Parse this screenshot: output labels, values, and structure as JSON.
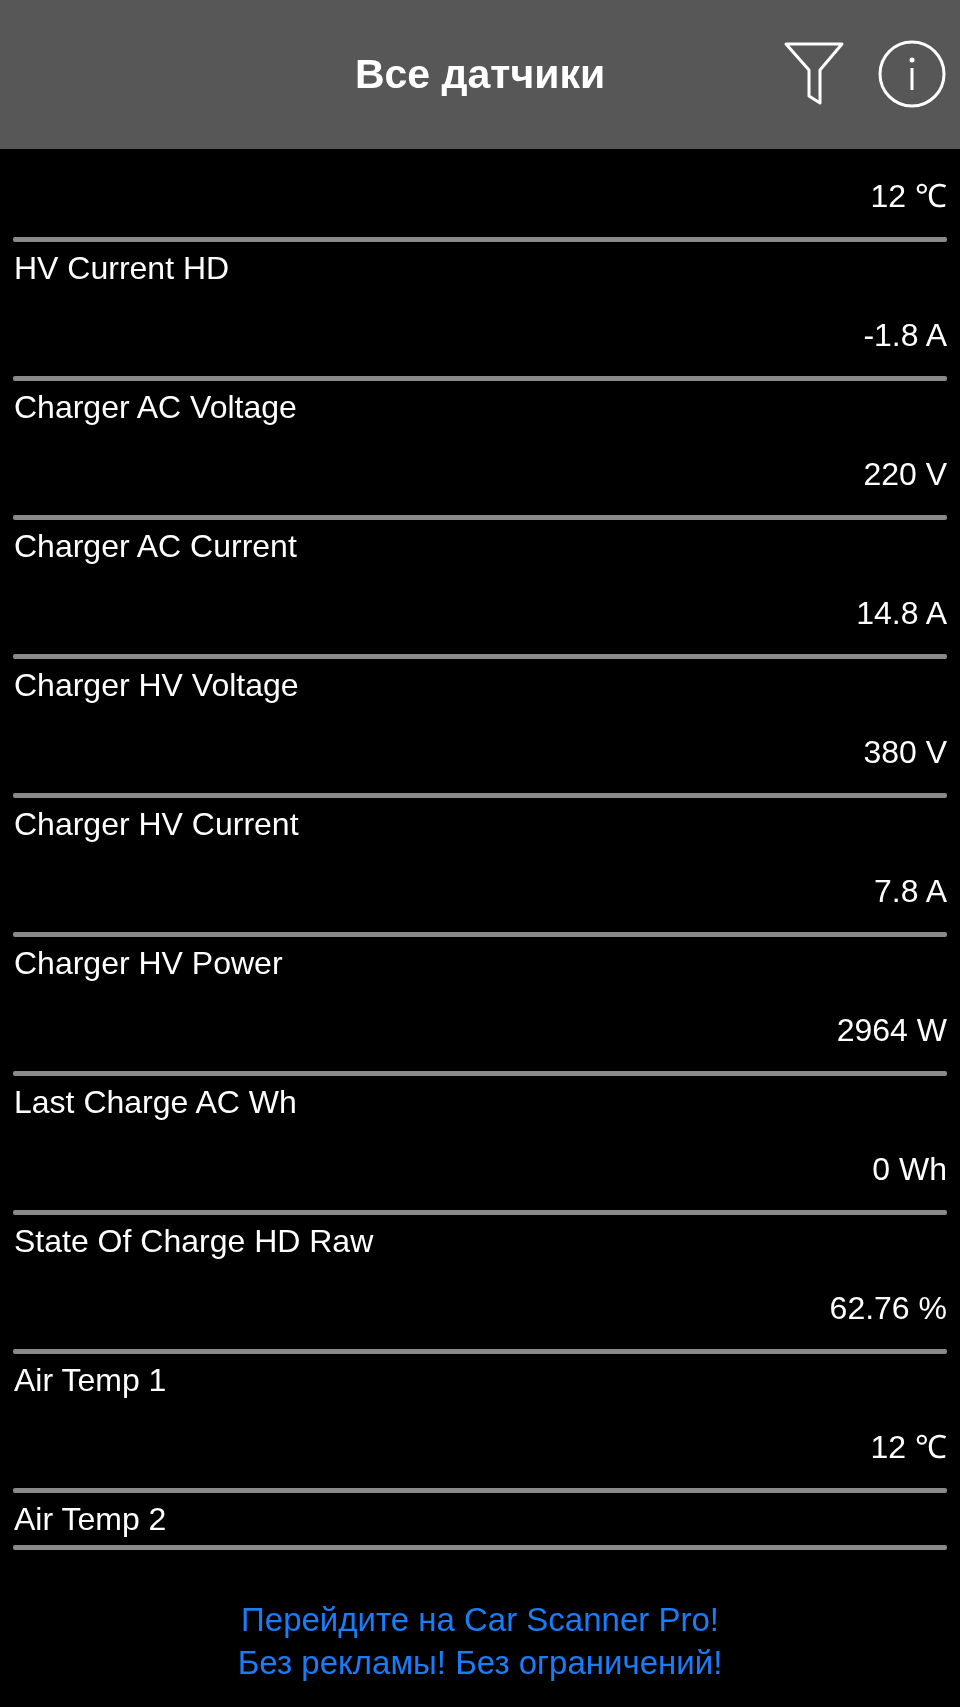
{
  "header": {
    "title": "Все датчики"
  },
  "sensors": [
    {
      "value": "12 ℃"
    },
    {
      "name": "HV Current HD",
      "value": "-1.8 A"
    },
    {
      "name": "Charger AC Voltage",
      "value": "220 V"
    },
    {
      "name": "Charger AC Current",
      "value": "14.8 A"
    },
    {
      "name": "Charger HV Voltage",
      "value": "380 V"
    },
    {
      "name": "Charger HV Current",
      "value": "7.8 A"
    },
    {
      "name": "Charger HV Power",
      "value": "2964 W"
    },
    {
      "name": "Last Charge AC Wh",
      "value": "0 Wh"
    },
    {
      "name": "State Of Charge HD Raw",
      "value": "62.76 %"
    },
    {
      "name": "Air Temp 1",
      "value": "12 ℃"
    },
    {
      "name": "Air Temp 2"
    }
  ],
  "promo": {
    "lines": [
      "Перейдите на Car Scanner Pro!",
      "Без рекламы! Без ограничений!"
    ]
  }
}
